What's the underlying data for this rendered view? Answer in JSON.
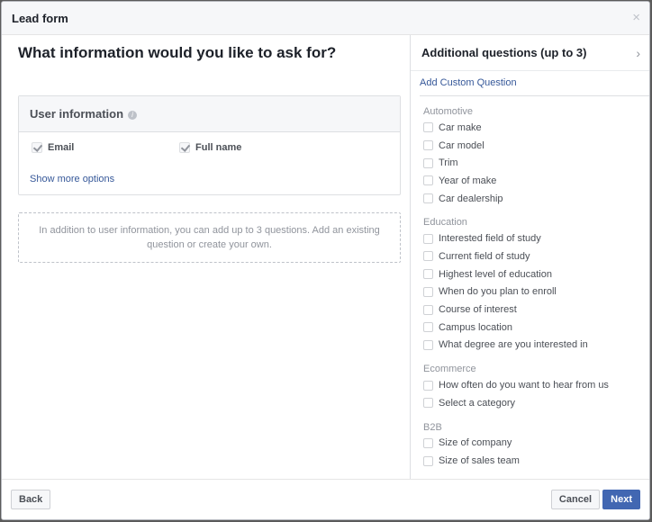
{
  "dialog": {
    "title": "Lead form",
    "close_symbol": "×"
  },
  "main": {
    "heading": "What information would you like to ask for?",
    "user_info": {
      "title": "User information",
      "info_glyph": "i",
      "fields": [
        {
          "label": "Email",
          "checked": true
        },
        {
          "label": "Full name",
          "checked": true
        }
      ],
      "show_more": "Show more options"
    },
    "hint": "In addition to user information, you can add up to 3 questions. Add an existing question or create your own."
  },
  "sidebar": {
    "title": "Additional questions (up to 3)",
    "chevron_symbol": "›",
    "add_custom": "Add Custom Question",
    "groups": [
      {
        "label": "Automotive",
        "items": [
          "Car make",
          "Car model",
          "Trim",
          "Year of make",
          "Car dealership"
        ]
      },
      {
        "label": "Education",
        "items": [
          "Interested field of study",
          "Current field of study",
          "Highest level of education",
          "When do you plan to enroll",
          "Course of interest",
          "Campus location",
          "What degree are you interested in"
        ]
      },
      {
        "label": "Ecommerce",
        "items": [
          "How often do you want to hear from us",
          "Select a category"
        ]
      },
      {
        "label": "B2B",
        "items": [
          "Size of company",
          "Size of sales team"
        ]
      }
    ]
  },
  "footer": {
    "back_label": "Back",
    "cancel_label": "Cancel",
    "next_label": "Next"
  },
  "colors": {
    "link": "#365899",
    "primary": "#4267b2",
    "muted": "#90949c"
  },
  "icons": {
    "close": "close-icon",
    "info": "info-icon",
    "chevron": "chevron-right-icon",
    "check": "checkmark-icon"
  }
}
